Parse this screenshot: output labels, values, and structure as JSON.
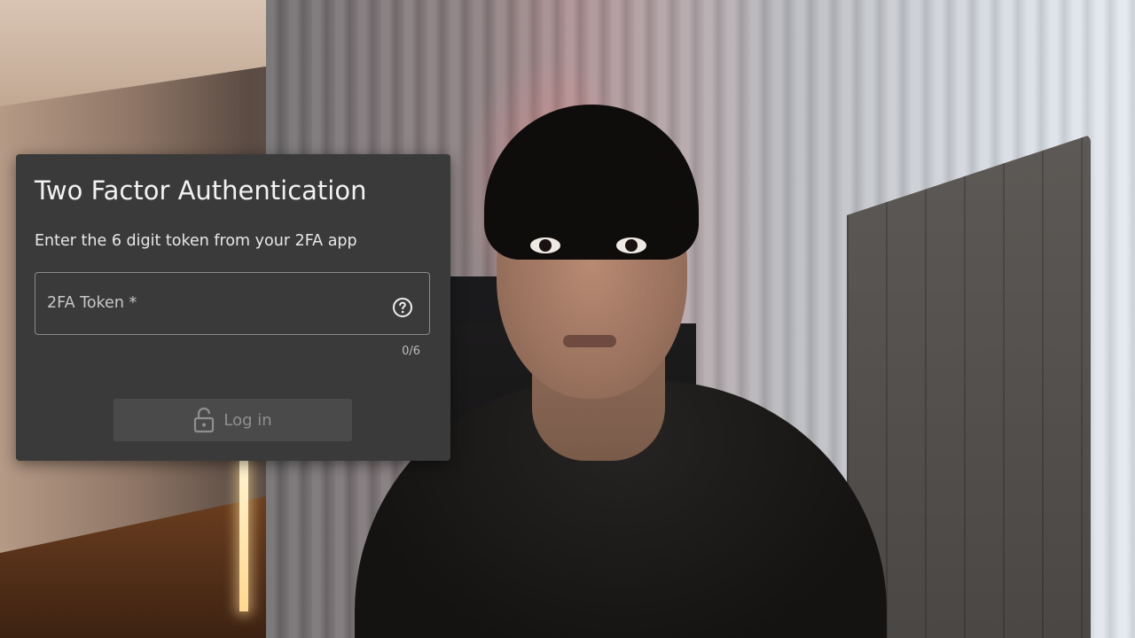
{
  "dialog": {
    "title": "Two Factor Authentication",
    "subtitle": "Enter the 6 digit token from your 2FA app",
    "token_field": {
      "label": "2FA Token *",
      "value": "",
      "counter": "0/6"
    },
    "login_button": {
      "label": "Log in",
      "icon": "lock-icon",
      "disabled": true
    }
  },
  "colors": {
    "dialog_bg": "#3a3a3a",
    "button_bg": "#4a4a4a",
    "text_primary": "#f2f2f2"
  }
}
